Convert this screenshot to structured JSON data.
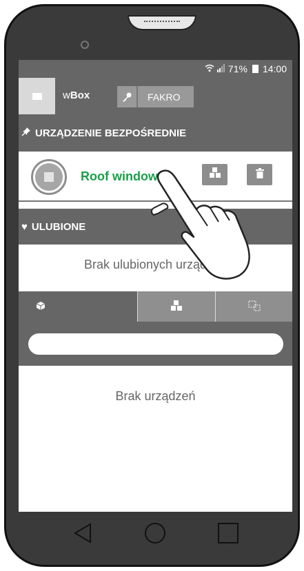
{
  "status_bar": {
    "wifi_icon": "wifi-icon",
    "signal_icon": "signal-icon",
    "battery": "71%",
    "time": "14:00"
  },
  "app_bar": {
    "title_prefix": "w",
    "title_bold": "Box",
    "brand_button": "FAKRO"
  },
  "direct_device": {
    "header": "URZĄDZENIE BEZPOŚREDNIE",
    "device_name": "Roof window>>"
  },
  "favorites": {
    "header": "ULUBIONE",
    "empty_text": "Brak ulubionych urządzeń"
  },
  "device_list": {
    "empty_text": "Brak urządzeń",
    "search_value": ""
  },
  "colors": {
    "accent_green": "#19a04a",
    "bar_gray": "#666666",
    "button_gray": "#8d8d8d"
  }
}
